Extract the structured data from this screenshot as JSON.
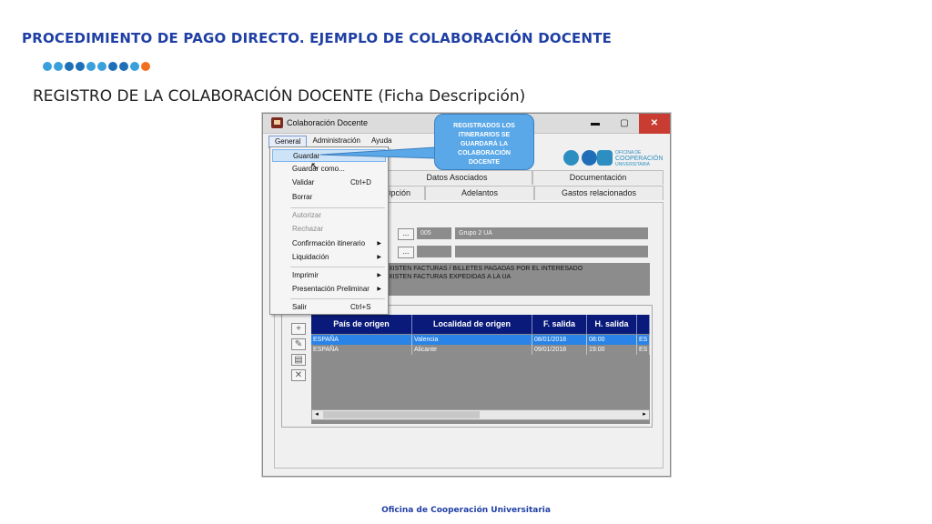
{
  "slide": {
    "title": "PROCEDIMIENTO DE PAGO DIRECTO. EJEMPLO DE COLABORACIÓN DOCENTE",
    "subtitle": "REGISTRO DE LA COLABORACIÓN DOCENTE (Ficha Descripción)",
    "footer": "Oficina de Cooperación Universitaria",
    "dot_colors": [
      "#3aa0dc",
      "#3aa0dc",
      "#1f6fb8",
      "#1f6fb8",
      "#3aa0dc",
      "#3aa0dc",
      "#1f6fb8",
      "#1f6fb8",
      "#3aa0dc",
      "#f07020"
    ]
  },
  "window": {
    "title": "Colaboración Docente",
    "minimize_glyph": "▬",
    "maximize_glyph": "▢",
    "close_glyph": "✕"
  },
  "menubar": [
    "General",
    "Administración",
    "Ayuda"
  ],
  "logo": {
    "line1": "OFICINA DE",
    "line2": "COOPERACIÓN",
    "line3": "UNIVERSITARIA"
  },
  "tabs": {
    "row1": [
      "Datos Asociados",
      "Documentación"
    ],
    "row2": [
      "cripción",
      "Adelantos",
      "Gastos relacionados"
    ]
  },
  "form": {
    "btn1": "...",
    "code1": "005",
    "name1": "Grupo 2 UA",
    "btn2": "...",
    "code2": "",
    "name2": "",
    "note_line1": "XISTEN FACTURAS / BILLETES PAGADAS POR EL INTERESADO",
    "note_line2": "XISTEN FACTURAS EXPEDIDAS A LA UA"
  },
  "toolbar_icons": [
    "add-icon",
    "edit-icon",
    "open-icon",
    "delete-icon"
  ],
  "grid": {
    "columns": [
      "País de origen",
      "Localidad de origen",
      "F. salida",
      "H. salida",
      ""
    ],
    "rows": [
      [
        "ESPAÑA",
        "Valencia",
        "08/01/2018",
        "08:00",
        "ES"
      ],
      [
        "ESPAÑA",
        "Alicante",
        "09/01/2018",
        "19:00",
        "ES"
      ]
    ],
    "scroll_left": "◂",
    "scroll_right": "▸"
  },
  "menu": {
    "items": [
      {
        "label": "Guardar",
        "shortcut": "",
        "disabled": false,
        "submenu": false
      },
      {
        "label": "Guardar como...",
        "shortcut": "",
        "disabled": false,
        "submenu": false
      },
      {
        "label": "Validar",
        "shortcut": "Ctrl+D",
        "disabled": false,
        "submenu": false
      },
      {
        "label": "Borrar",
        "shortcut": "",
        "disabled": false,
        "submenu": false
      },
      {
        "label": "Autorizar",
        "shortcut": "",
        "disabled": true,
        "submenu": false
      },
      {
        "label": "Rechazar",
        "shortcut": "",
        "disabled": true,
        "submenu": false
      },
      {
        "label": "Confirmación itinerario",
        "shortcut": "",
        "disabled": false,
        "submenu": true
      },
      {
        "label": "Liquidación",
        "shortcut": "",
        "disabled": false,
        "submenu": true
      },
      {
        "label": "Imprimir",
        "shortcut": "",
        "disabled": false,
        "submenu": true
      },
      {
        "label": "Presentación Preliminar",
        "shortcut": "",
        "disabled": false,
        "submenu": true
      },
      {
        "label": "Salir",
        "shortcut": "Ctrl+S",
        "disabled": false,
        "submenu": false
      }
    ],
    "submenu_arrow": "▶"
  },
  "callout": {
    "line1": "REGISTRADOS LOS",
    "line2": "ITINERARIOS SE",
    "line3": "GUARDARÁ LA",
    "line4": "COLABORACIÓN",
    "line5": "DOCENTE"
  }
}
